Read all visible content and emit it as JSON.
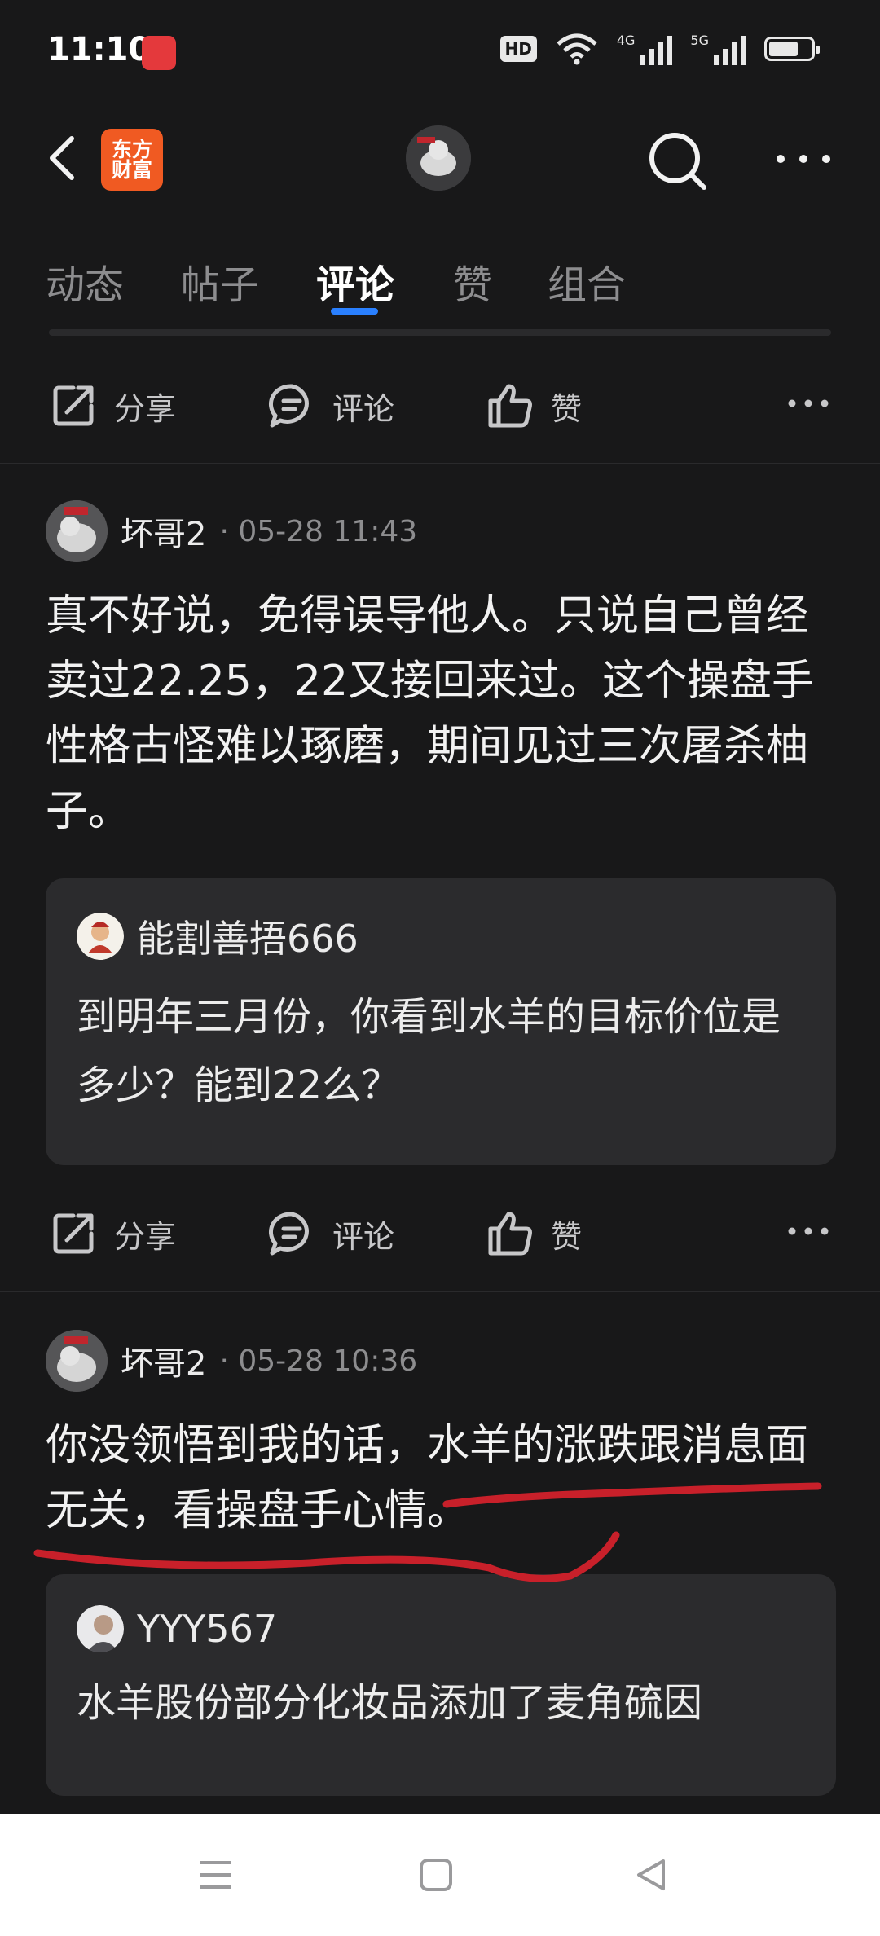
{
  "status_bar": {
    "time": "11:10",
    "hd_label": "HD",
    "signal_1_label": "4G",
    "signal_2_label": "5G",
    "battery_level": 0.7
  },
  "header": {
    "logo_line1": "东方",
    "logo_line2": "财富"
  },
  "tabs": [
    {
      "label": "动态"
    },
    {
      "label": "帖子"
    },
    {
      "label": "评论"
    },
    {
      "label": "赞"
    },
    {
      "label": "组合"
    }
  ],
  "actions": {
    "share": "分享",
    "comment": "评论",
    "like": "赞"
  },
  "posts": [
    {
      "author": "坏哥2",
      "meta": "· 05-28 11:43",
      "text": "真不好说，免得误导他人。只说自己曾经卖过22.25，22又接回来过。这个操盘手性格古怪难以琢磨，期间见过三次屠杀柚子。",
      "quote": {
        "author": "能割善捂666",
        "text": "到明年三月份，你看到水羊的目标价位是多少？能到22么？"
      }
    },
    {
      "author": "坏哥2",
      "meta": "· 05-28 10:36",
      "text": "你没领悟到我的话，水羊的涨跌跟消息面无关，看操盘手心情。",
      "quote": {
        "author": "YYY567",
        "text": "水羊股份部分化妆品添加了麦角硫因"
      }
    }
  ],
  "colors": {
    "background": "#181819",
    "accent_blue": "#2a80ff",
    "logo_orange": "#f05a22",
    "annotation_red": "#c8202a"
  }
}
